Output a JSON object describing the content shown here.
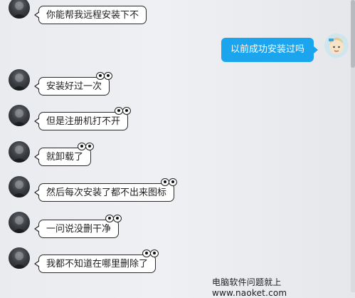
{
  "messages": [
    {
      "text": "你能帮我远程安装下不",
      "eyes": false
    },
    {
      "text": "安装好过一次",
      "eyes": true
    },
    {
      "text": "但是注册机打不开",
      "eyes": true
    },
    {
      "text": "就卸载了",
      "eyes": true
    },
    {
      "text": "然后每次安装了都不出来图标",
      "eyes": true
    },
    {
      "text": "一问说没删干净",
      "eyes": true
    },
    {
      "text": "我都不知道在哪里删除了",
      "eyes": true
    }
  ],
  "sent": {
    "text": "以前成功安装过吗"
  },
  "watermark": {
    "text": "电脑软件问题就上www.naoket.com"
  },
  "colors": {
    "sent_bubble": "#1aa5ee",
    "bubble_border": "#2a2a2a"
  },
  "icons": {
    "other_avatar": "dark-person-avatar-icon",
    "my_avatar": "cartoon-avatar-icon",
    "eyes": "cartoon-eyes-icon"
  }
}
